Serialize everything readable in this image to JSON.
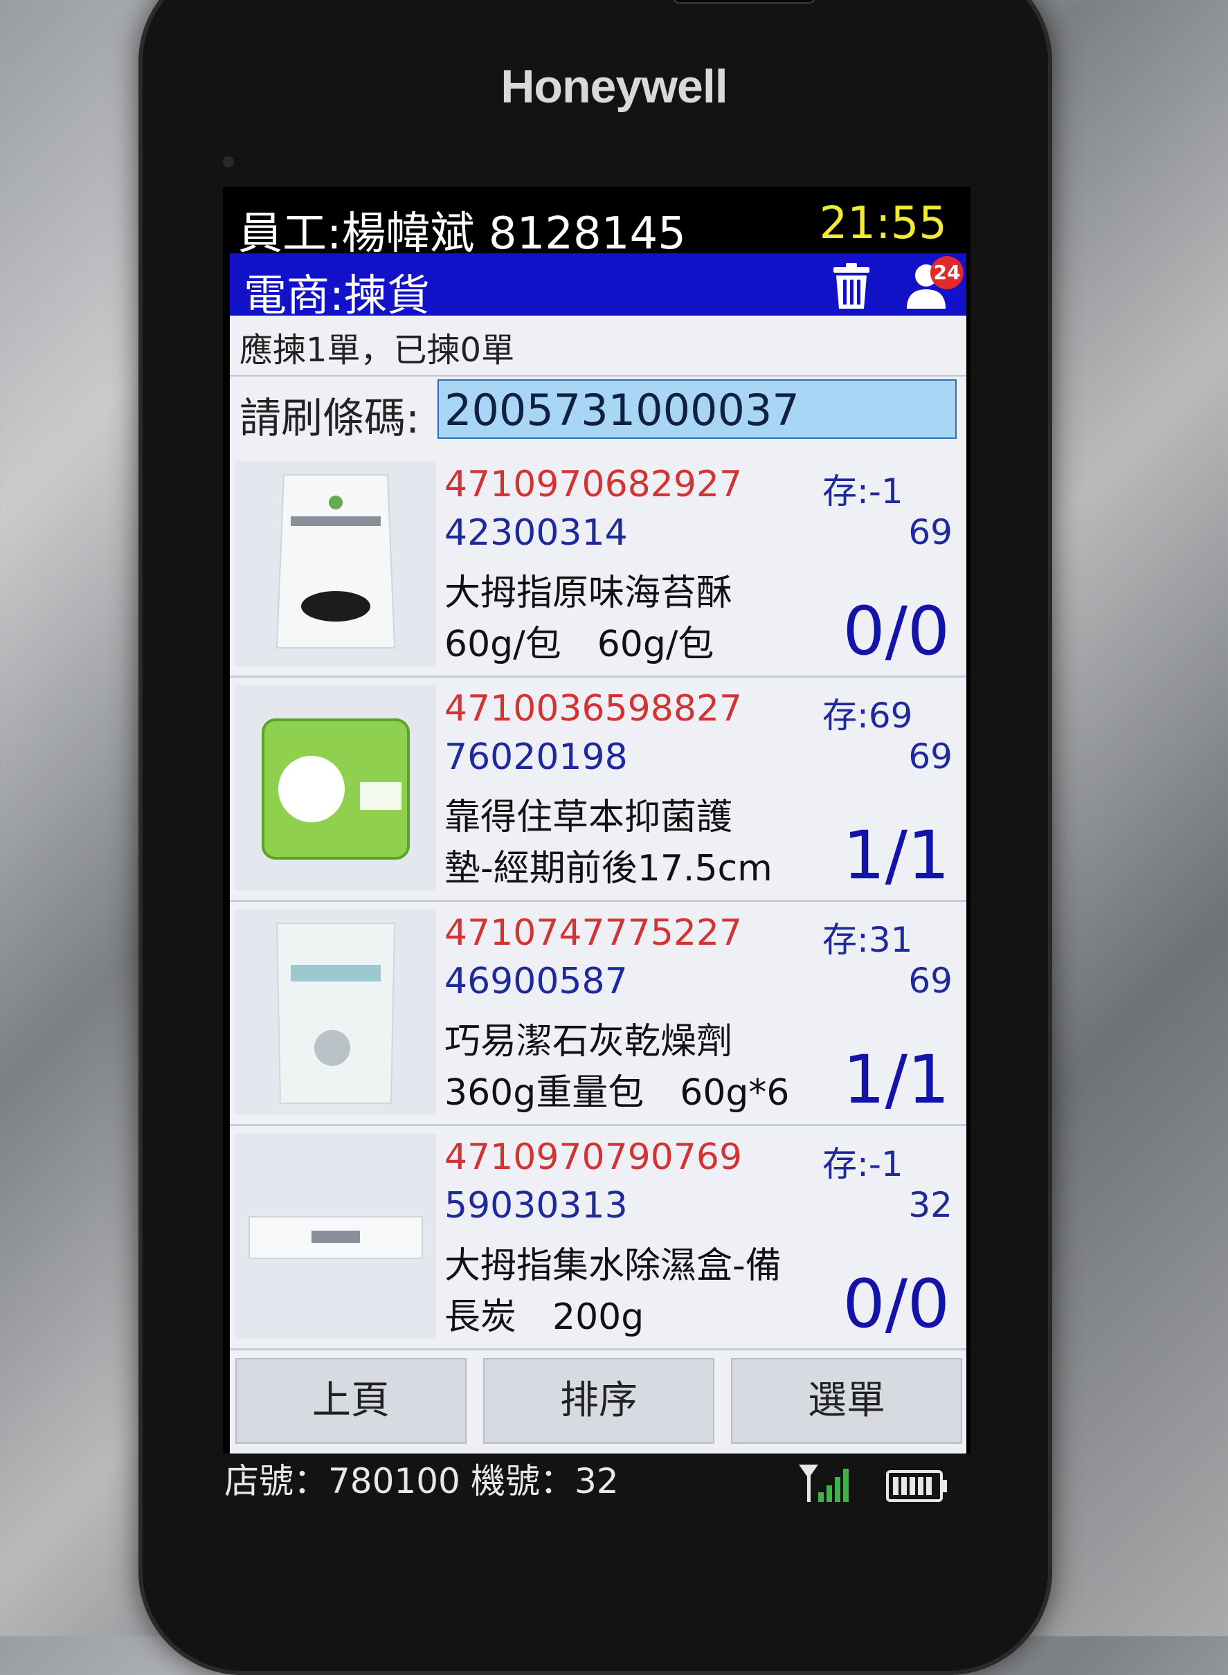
{
  "device": {
    "brand": "Honeywell"
  },
  "status": {
    "employee": "員工:楊幃斌 8128145",
    "time": "21:55"
  },
  "header": {
    "title": "電商:揀貨",
    "notification_count": "24"
  },
  "summary": {
    "counts": "應揀1單，已揀0單"
  },
  "scan": {
    "label": "請刷條碼:",
    "value": "2005731000037"
  },
  "items": [
    {
      "ean": "4710970682927",
      "stock": "存:-1",
      "code": "42300314",
      "qty": "69",
      "name_line1": "大拇指原味海苔酥",
      "name_line2": "60g/包　60g/包",
      "ratio": "0/0"
    },
    {
      "ean": "4710036598827",
      "stock": "存:69",
      "code": "76020198",
      "qty": "69",
      "name_line1": "靠得住草本抑菌護",
      "name_line2": "墊-經期前後17.5cm",
      "ratio": "1/1"
    },
    {
      "ean": "4710747775227",
      "stock": "存:31",
      "code": "46900587",
      "qty": "69",
      "name_line1": "巧易潔石灰乾燥劑",
      "name_line2": "360g重量包　60g*6",
      "ratio": "1/1"
    },
    {
      "ean": "4710970790769",
      "stock": "存:-1",
      "code": "59030313",
      "qty": "32",
      "name_line1": "大拇指集水除濕盒-備",
      "name_line2": "長炭　200g",
      "ratio": "0/0"
    }
  ],
  "buttons": {
    "prev": "上頁",
    "sort": "排序",
    "select": "選單"
  },
  "footer": {
    "shop": "店號：780100",
    "machine": "機號：32"
  }
}
